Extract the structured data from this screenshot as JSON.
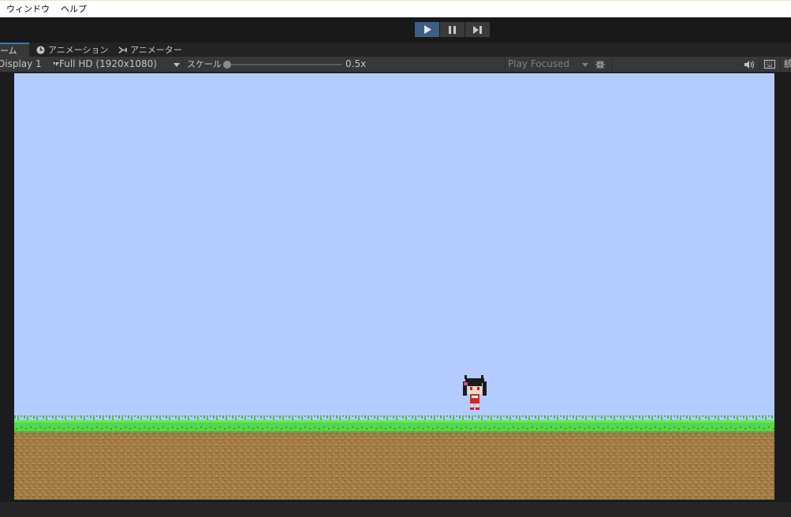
{
  "menubar": {
    "items": [
      "ウィンドウ",
      "ヘルプ"
    ]
  },
  "toolbar": {
    "play_state": "playing"
  },
  "tabs": [
    {
      "label": "ーム",
      "icon": "game-icon",
      "active": true
    },
    {
      "label": "アニメーション",
      "icon": "clock-icon",
      "active": false
    },
    {
      "label": "アニメーター",
      "icon": "animator-icon",
      "active": false
    }
  ],
  "game_toolbar": {
    "display": "Display 1",
    "resolution": "Full HD (1920x1080)",
    "scale_label": "スケール",
    "scale_value": "0.5x",
    "play_mode": "Play Focused",
    "stats_label": "統"
  },
  "colors": {
    "sky": "#b3cbff",
    "grass": "#53d84a",
    "dirt": "#a17c45",
    "accent": "#3d5f86"
  },
  "scene": {
    "character": "pixel-character",
    "ground": "grass-dirt-ground"
  }
}
